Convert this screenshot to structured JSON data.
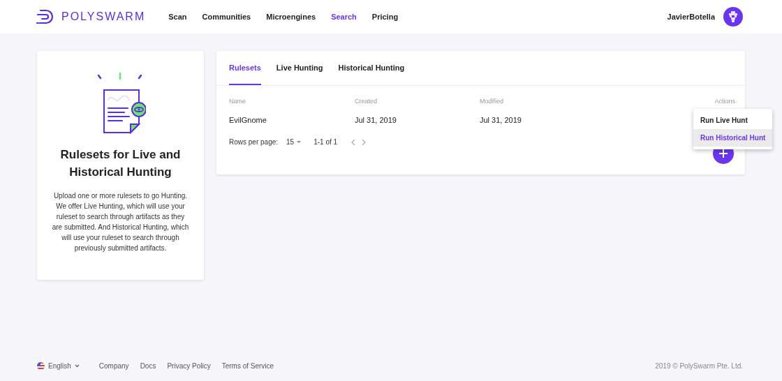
{
  "header": {
    "logo": "POLYSWARM",
    "nav": [
      {
        "label": "Scan",
        "selected": false
      },
      {
        "label": "Communities",
        "selected": false
      },
      {
        "label": "Microengines",
        "selected": false
      },
      {
        "label": "Search",
        "selected": true
      },
      {
        "label": "Pricing",
        "selected": false
      }
    ],
    "user": "JavierBotella"
  },
  "info_card": {
    "title": "Rulesets for Live and Historical Hunting",
    "body": "Upload one or more rulesets to go Hunting. We offer Live Hunting, which will use your ruleset to search through artifacts as they are submitted. And Historical Hunting, which will use your ruleset to search through previously submitted artifacts."
  },
  "tabs": [
    {
      "label": "Rulesets",
      "selected": true
    },
    {
      "label": "Live Hunting",
      "selected": false
    },
    {
      "label": "Historical Hunting",
      "selected": false
    }
  ],
  "table": {
    "columns": [
      "Name",
      "Created",
      "Modified",
      "Actions"
    ],
    "rows": [
      {
        "name": "EvilGnome",
        "created": "Jul 31, 2019",
        "modified": "Jul 31, 2019"
      }
    ]
  },
  "pagination": {
    "label": "Rows per page:",
    "rows_per_page": "15",
    "range": "1-1 of 1"
  },
  "actions_menu": [
    {
      "label": "Run Live Hunt",
      "selected": false
    },
    {
      "label": "Run Historical Hunt",
      "selected": true
    }
  ],
  "footer": {
    "language": "English",
    "links": [
      "Company",
      "Docs",
      "Privacy Policy",
      "Terms of Service"
    ],
    "copyright": "2019 © PolySwarm Pte. Ltd."
  }
}
